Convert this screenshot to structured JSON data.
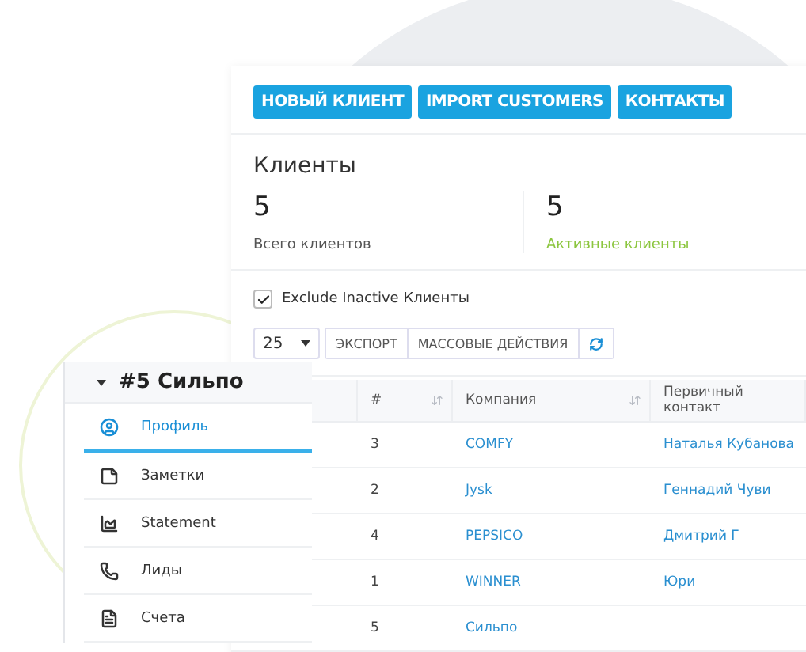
{
  "toolbar_buttons": [
    "НОВЫЙ КЛИЕНТ",
    "IMPORT CUSTOMERS",
    "КОНТАКТЫ"
  ],
  "section_title": "Клиенты",
  "stats": [
    {
      "value": "5",
      "label": "Всего клиентов",
      "color": "#555555"
    },
    {
      "value": "5",
      "label": "Активные клиенты",
      "color": "#8cc63f"
    }
  ],
  "exclude_inactive": {
    "label": "Exclude Inactive Клиенты",
    "checked": true
  },
  "page_size": "25",
  "actions": [
    "ЭКСПОРТ",
    "МАССОВЫЕ ДЕЙСТВИЯ"
  ],
  "table": {
    "columns": [
      {
        "label": "#",
        "sortable": true
      },
      {
        "label": "Компания",
        "sortable": true
      },
      {
        "label": "Первичный контакт",
        "sortable": false
      }
    ],
    "rows": [
      [
        "3",
        "COMFY",
        "Наталья Кубанова"
      ],
      [
        "2",
        "Jysk",
        "Геннадий Чуви"
      ],
      [
        "4",
        "PEPSICO",
        "Дмитрий Г"
      ],
      [
        "1",
        "WINNER",
        "Юри"
      ],
      [
        "5",
        "Сильпо",
        ""
      ]
    ]
  },
  "sidebar": {
    "title": "#5 Сильпо",
    "items": [
      {
        "label": "Профиль",
        "selected": true
      },
      {
        "label": "Заметки",
        "selected": false
      },
      {
        "label": "Statement",
        "selected": false
      },
      {
        "label": "Лиды",
        "selected": false
      },
      {
        "label": "Счета",
        "selected": false
      }
    ]
  }
}
